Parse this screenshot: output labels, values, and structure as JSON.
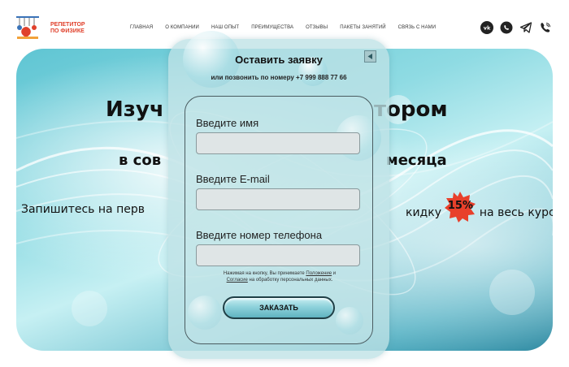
{
  "header": {
    "logo_line1": "РЕПЕТИТОР",
    "logo_line2": "ПО ФИЗИКЕ",
    "nav": [
      "ГЛАВНАЯ",
      "О КОМПАНИИ",
      "НАШ ОПЫТ",
      "ПРЕИМУЩЕСТВА",
      "ОТЗЫВЫ",
      "ПАКЕТЫ ЗАНЯТИЙ",
      "СВЯЗЬ С НАМИ"
    ],
    "socials": [
      "vk-icon",
      "whatsapp-icon",
      "telegram-icon",
      "viber-icon"
    ]
  },
  "hero": {
    "title_line1_left": "Изуч",
    "title_line1_right": "тором",
    "title_line2_left": "в сов",
    "title_line2_right": "месяца",
    "promo_left": "Запишитесь на перв",
    "promo_right_prefix": "кидку",
    "promo_badge": "15%",
    "promo_right_suffix": "на весь курс"
  },
  "modal": {
    "title": "Оставить заявку",
    "subtitle": "или позвонить по номеру +7 999 888 77 66",
    "name_label": "Введите имя",
    "email_label": "Введите E-mail",
    "phone_label": "Введите номер телефона",
    "name_value": "",
    "email_value": "",
    "phone_value": "",
    "consent_prefix": "Нажимая на кнопку, Вы принимаете",
    "consent_link1": "Положение",
    "consent_and": "и",
    "consent_link2": "Согласие",
    "consent_suffix": "на обработку персональных данных.",
    "submit_label": "ЗАКАЗАТЬ"
  },
  "colors": {
    "brand": "#e0402b",
    "accent": "#5fc5d3",
    "badge": "#e8402b"
  }
}
